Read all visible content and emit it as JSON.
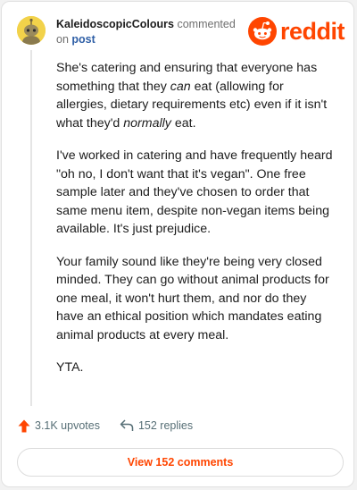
{
  "comment": {
    "username": "KaleidoscopicColours",
    "action_text": "commented",
    "on_text": "on",
    "post_link": "post",
    "paragraphs": [
      {
        "pre": "She's catering and ensuring that everyone has something that they ",
        "em1": "can",
        "mid": " eat (allowing for allergies, dietary requirements etc) even if it isn't what they'd ",
        "em2": "normally",
        "post": " eat."
      },
      {
        "text": "I've worked in catering and have frequently heard \"oh no, I don't want that it's vegan\". One free sample later and they've chosen to order that same menu item, despite non-vegan items being available. It's just prejudice."
      },
      {
        "text": "Your family sound like they're being very closed minded. They can go without animal products for one meal, it won't hurt them, and nor do they have an ethical position which mandates eating animal products at every meal."
      },
      {
        "text": "YTA."
      }
    ]
  },
  "brand": {
    "wordmark": "reddit",
    "icon": "reddit-snoo-icon",
    "color": "#ff4500"
  },
  "actions": {
    "upvotes": "3.1K upvotes",
    "replies": "152 replies",
    "view_button": "View 152 comments"
  },
  "icons": {
    "avatar": "avatar-icon",
    "upvote": "upvote-arrow-icon",
    "reply": "reply-arrow-icon"
  }
}
